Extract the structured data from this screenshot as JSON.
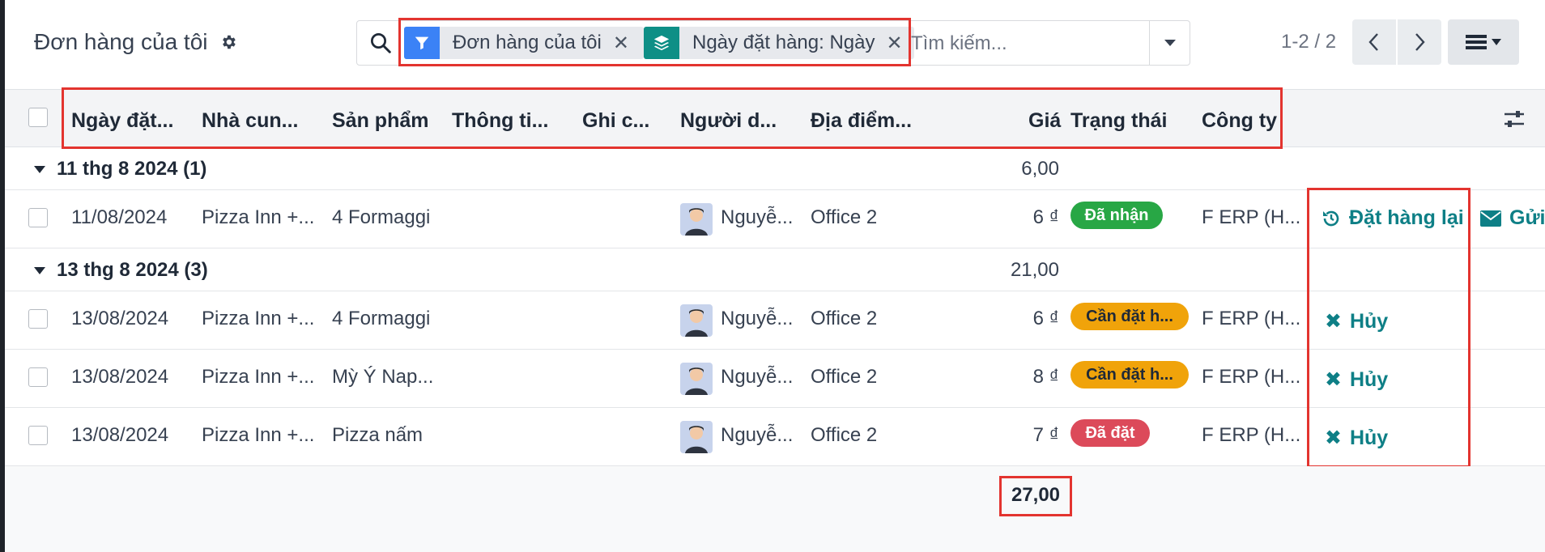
{
  "header": {
    "title": "Đơn hàng của tôi"
  },
  "search": {
    "facets": [
      {
        "label": "Đơn hàng của tôi",
        "icon": "filter-icon",
        "color": "#3b82f6"
      },
      {
        "label": "Ngày đặt hàng: Ngày",
        "icon": "layers-icon",
        "color": "#0e8f86"
      }
    ],
    "placeholder": "Tìm kiếm..."
  },
  "pager": {
    "value": "1-2 / 2"
  },
  "table": {
    "columns": [
      "Ngày đặt...",
      "Nhà cun...",
      "Sản phẩm",
      "Thông ti...",
      "Ghi c...",
      "Người d...",
      "Địa điểm...",
      "Giá",
      "Trạng thái",
      "Công ty"
    ],
    "groups": [
      {
        "label": "11 thg 8 2024 (1)",
        "total": "6,00",
        "rows": [
          {
            "date": "11/08/2024",
            "vendor": "Pizza Inn +...",
            "product": "4 Formaggi",
            "user": "Nguyễ...",
            "location": "Office 2",
            "price": "6 ₫",
            "status": "Đã nhận",
            "status_color": "#28a745",
            "company": "F ERP (H...",
            "action": "Đặt hàng lại",
            "extra_action": "Gửi"
          }
        ]
      },
      {
        "label": "13 thg 8 2024 (3)",
        "total": "21,00",
        "rows": [
          {
            "date": "13/08/2024",
            "vendor": "Pizza Inn +...",
            "product": "4 Formaggi",
            "user": "Nguyễ...",
            "location": "Office 2",
            "price": "6 ₫",
            "status": "Cần đặt h...",
            "status_color": "#f0a30a",
            "company": "F ERP (H...",
            "action": "Hủy"
          },
          {
            "date": "13/08/2024",
            "vendor": "Pizza Inn +...",
            "product": "Mỳ Ý Nap...",
            "user": "Nguyễ...",
            "location": "Office 2",
            "price": "8 ₫",
            "status": "Cần đặt h...",
            "status_color": "#f0a30a",
            "company": "F ERP (H...",
            "action": "Hủy"
          },
          {
            "date": "13/08/2024",
            "vendor": "Pizza Inn +...",
            "product": "Pizza nấm",
            "user": "Nguyễ...",
            "location": "Office 2",
            "price": "7 ₫",
            "status": "Đã đặt",
            "status_color": "#dc4a5a",
            "company": "F ERP (H...",
            "action": "Hủy"
          }
        ]
      }
    ],
    "grand_total": "27,00"
  },
  "colors": {
    "highlight": "#e3342f",
    "action": "#0e7f86"
  }
}
